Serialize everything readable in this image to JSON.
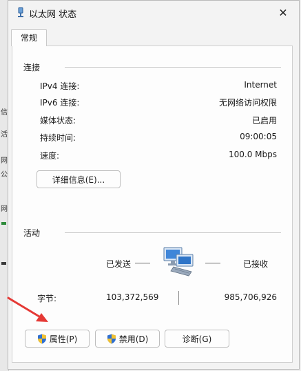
{
  "window": {
    "title": "以太网 状态",
    "close": "✕"
  },
  "tabs": [
    {
      "label": "常规"
    }
  ],
  "connection": {
    "title": "连接",
    "rows": [
      {
        "label": "IPv4 连接:",
        "value": "Internet"
      },
      {
        "label": "IPv6 连接:",
        "value": "无网络访问权限"
      },
      {
        "label": "媒体状态:",
        "value": "已启用"
      },
      {
        "label": "持续时间:",
        "value": "09:00:05"
      },
      {
        "label": "速度:",
        "value": "100.0 Mbps"
      }
    ],
    "details_button": "详细信息(E)..."
  },
  "activity": {
    "title": "活动",
    "sent_label": "已发送",
    "received_label": "已接收",
    "bytes_label": "字节:",
    "bytes_sent": "103,372,569",
    "bytes_received": "985,706,926"
  },
  "buttons": {
    "properties": "属性(P)",
    "disable": "禁用(D)",
    "diagnose": "诊断(G)"
  },
  "colors": {
    "annotation_arrow": "#e53935",
    "shield_blue": "#2f6fd0",
    "shield_yellow": "#f2c230"
  },
  "background": {
    "fragments": [
      "信",
      "活",
      "网",
      "公",
      "网"
    ]
  }
}
